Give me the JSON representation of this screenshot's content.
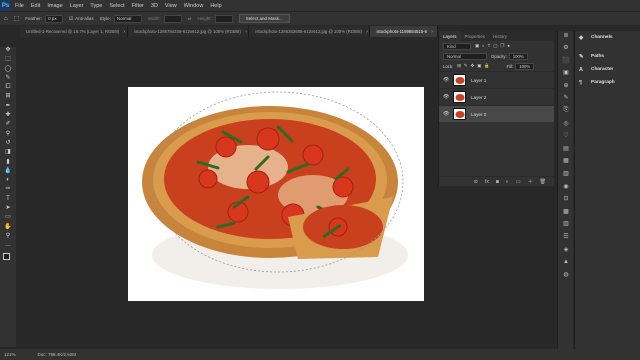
{
  "app": {
    "logo": "Ps"
  },
  "menu": [
    "File",
    "Edit",
    "Image",
    "Layer",
    "Type",
    "Select",
    "Filter",
    "3D",
    "View",
    "Window",
    "Help"
  ],
  "options": {
    "feather_label": "Feather:",
    "feather_value": "0 px",
    "antialias_label": "Anti-alias",
    "style_label": "Style:",
    "style_value": "Normal",
    "width_label": "Width:",
    "height_label": "Height:",
    "select_mask": "Select and Mask..."
  },
  "tabs": [
    {
      "label": "Untitled-1-Recovered @ 16.7% (Layer 1, RGB/8)",
      "active": false
    },
    {
      "label": "istockphoto-1285784346-612x612.jpg @ 100% (RGB/8)",
      "active": false
    },
    {
      "label": "istockphoto-1286353685-612x612.jpg @ 100% (RGB/8)",
      "active": false
    },
    {
      "label": "istockphoto-1189884515-6",
      "active": true
    }
  ],
  "tools": [
    "move-tool",
    "marquee-tool",
    "lasso-tool",
    "quick-select-tool",
    "crop-tool",
    "frame-tool",
    "eyedropper-tool",
    "healing-tool",
    "brush-tool",
    "stamp-tool",
    "history-brush-tool",
    "eraser-tool",
    "gradient-tool",
    "blur-tool",
    "dodge-tool",
    "pen-tool",
    "type-tool",
    "path-select-tool",
    "rectangle-tool",
    "hand-tool",
    "zoom-tool",
    "more-tools"
  ],
  "tool_glyphs": [
    "✥",
    "⬚",
    "◯",
    "✎",
    "⧠",
    "⊞",
    "✒",
    "✚",
    "✐",
    "⚲",
    "↺",
    "◨",
    "▮",
    "💧",
    "◐",
    "✑",
    "T",
    "➤",
    "▭",
    "✋",
    "⚲",
    "…"
  ],
  "status": {
    "zoom": "121%",
    "doc": "Doc: 788.4K/2.52M"
  },
  "layers_panel": {
    "tabs": [
      "Layers",
      "Properties",
      "History"
    ],
    "kind": "Kind",
    "blend": "Normal",
    "opacity_label": "Opacity:",
    "opacity": "100%",
    "lock_label": "Lock:",
    "fill_label": "Fill:",
    "fill": "100%",
    "layers": [
      {
        "name": "Layer 1",
        "selected": false
      },
      {
        "name": "Layer 2",
        "selected": false
      },
      {
        "name": "Layer 0",
        "selected": true
      }
    ],
    "footer_icons": [
      "link-icon",
      "fx-icon",
      "mask-icon",
      "adjustment-icon",
      "group-icon",
      "new-layer-icon",
      "trash-icon"
    ],
    "footer_glyphs": [
      "⊘",
      "fx",
      "◙",
      "◐",
      "▭",
      "＋",
      "🗑"
    ]
  },
  "right_panel": {
    "items": [
      {
        "label": "Channels",
        "glyph": "◆"
      },
      {
        "label": "Paths",
        "glyph": "✎"
      },
      {
        "label": "Character",
        "glyph": "A"
      },
      {
        "label": "Paragraph",
        "glyph": "¶"
      }
    ]
  },
  "side_icons": [
    "≣",
    "⚙",
    "⬛",
    "▣",
    "⊕",
    "✎",
    "⎘",
    "◎",
    "♡",
    "▤",
    "▦",
    "▨",
    "◉",
    "⊡",
    "▩",
    "▥",
    "☰",
    "◈",
    "▲",
    "◍"
  ],
  "colors": {
    "accent": "#1a3a5c",
    "panel": "#323232",
    "bg": "#282828",
    "selected": "#484848"
  }
}
